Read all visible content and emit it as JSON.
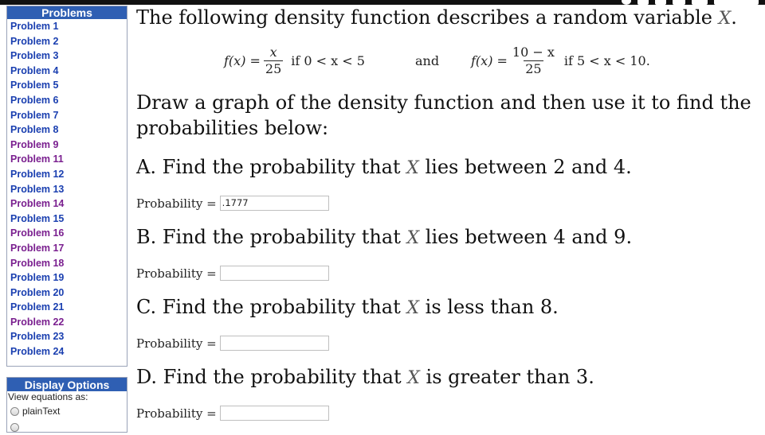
{
  "sidebar": {
    "problems_header": "Problems",
    "problems": [
      {
        "label": "Problem 1",
        "state": "unvisited"
      },
      {
        "label": "Problem 2",
        "state": "unvisited"
      },
      {
        "label": "Problem 3",
        "state": "unvisited"
      },
      {
        "label": "Problem 4",
        "state": "unvisited"
      },
      {
        "label": "Problem 5",
        "state": "unvisited"
      },
      {
        "label": "Problem 6",
        "state": "unvisited"
      },
      {
        "label": "Problem 7",
        "state": "unvisited"
      },
      {
        "label": "Problem 8",
        "state": "unvisited"
      },
      {
        "label": "Problem 9",
        "state": "visited"
      },
      {
        "label": "Problem 11",
        "state": "visited"
      },
      {
        "label": "Problem 12",
        "state": "unvisited"
      },
      {
        "label": "Problem 13",
        "state": "unvisited"
      },
      {
        "label": "Problem 14",
        "state": "visited"
      },
      {
        "label": "Problem 15",
        "state": "unvisited"
      },
      {
        "label": "Problem 16",
        "state": "visited"
      },
      {
        "label": "Problem 17",
        "state": "visited"
      },
      {
        "label": "Problem 18",
        "state": "visited"
      },
      {
        "label": "Problem 19",
        "state": "unvisited"
      },
      {
        "label": "Problem 20",
        "state": "unvisited"
      },
      {
        "label": "Problem 21",
        "state": "unvisited"
      },
      {
        "label": "Problem 22",
        "state": "visited"
      },
      {
        "label": "Problem 23",
        "state": "unvisited"
      },
      {
        "label": "Problem 24",
        "state": "unvisited"
      }
    ],
    "display_options_header": "Display Options",
    "view_equations_label": "View equations as:",
    "radio_options": [
      "plainText"
    ]
  },
  "problem": {
    "intro_before_var": "The following density function describes a random variable ",
    "var": "X",
    "intro_after_var": ".",
    "equation": {
      "lhs1": "f(x) =",
      "num1": "x",
      "den1": "25",
      "cond1": "if  0 < x < 5",
      "joiner": "and",
      "lhs2": "f(x) =",
      "num2": "10 − x",
      "den2": "25",
      "cond2": "if  5 < x < 10."
    },
    "instruction_line1": "Draw a graph of the density function and then use it to find the",
    "instruction_line2": "probabilities below:",
    "parts": [
      {
        "prefix": "A. Find the probability that ",
        "var": "X",
        "suffix": " lies between 2 and 4.",
        "answer_label": "Probability =",
        "answer_value": ".1777"
      },
      {
        "prefix": "B. Find the probability that ",
        "var": "X",
        "suffix": " lies between 4 and 9.",
        "answer_label": "Probability =",
        "answer_value": ""
      },
      {
        "prefix": "C. Find the probability that ",
        "var": "X",
        "suffix": " is less than 8.",
        "answer_label": "Probability =",
        "answer_value": ""
      },
      {
        "prefix": "D. Find the probability that ",
        "var": "X",
        "suffix": " is greater than 3.",
        "answer_label": "Probability =",
        "answer_value": ""
      }
    ]
  },
  "colors": {
    "panel_header": "#2f5fb3",
    "link_unvisited": "#1a3fb0",
    "link_visited": "#7a1f8f"
  }
}
